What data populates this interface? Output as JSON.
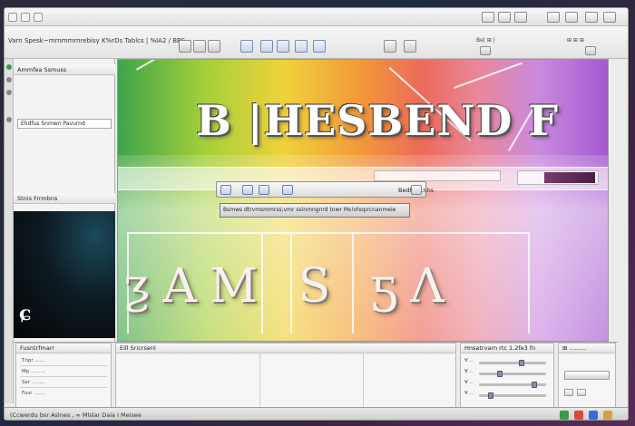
{
  "titlebar": {
    "left_controls": [
      "close-button",
      "minimize-button",
      "maximize-button"
    ],
    "right_icons": [
      "pane-icon",
      "window-icon",
      "grid-icon",
      "settings-icon"
    ]
  },
  "toolbar": {
    "menu_text": "Varn Spesk~mrnmmrnrebisy K%rDs Tablcs | %IA2 / BBS",
    "right_labels": [
      "Be| ⊞ |",
      "⊞ ⊞  ⊞"
    ]
  },
  "left_panel": {
    "header_1": "Ammfea Ssmuss",
    "field_1": "Ehdfus Snmwn  Pavurnd",
    "header_2": "Stnis  Frrmbns",
    "preview_glyph": "ɕ"
  },
  "canvas": {
    "title_art": "B |HESBEND F",
    "bottom_art": "ƺAM S ƽɅ",
    "float_toolbar_label": "Bedlmr .nhs",
    "float_bar_text": "Bsmws dtrvmsmmrss;vmr ssinmngnrd tnwr Ms!ohoprcnanmeie"
  },
  "bottom_panels": {
    "panel_1": {
      "header": "Fusntrfmarr",
      "rows": [
        "Tnpr ......",
        "Mp .........",
        "Sxr ........",
        "Fusr ......."
      ]
    },
    "panel_2": {
      "header": "Eill Sricrsenl"
    },
    "panel_3": {
      "header": "Hnsatrvarn rtc 1.2fe3 fn",
      "rows": [
        "Ɐ ..",
        "Ɐ ..",
        "Ɐ ..",
        "Ɐ .."
      ]
    },
    "panel_4": {
      "header": "⊞ ........."
    }
  },
  "statusbar": {
    "text": "(Ccwerdu bsr   Aslnes  ,  ∞   Mlslar   Daia I   Meisee",
    "tray_colors": [
      "#3a9a4a",
      "#d84a3a",
      "#3a6ad8",
      "#d8a23a"
    ]
  }
}
